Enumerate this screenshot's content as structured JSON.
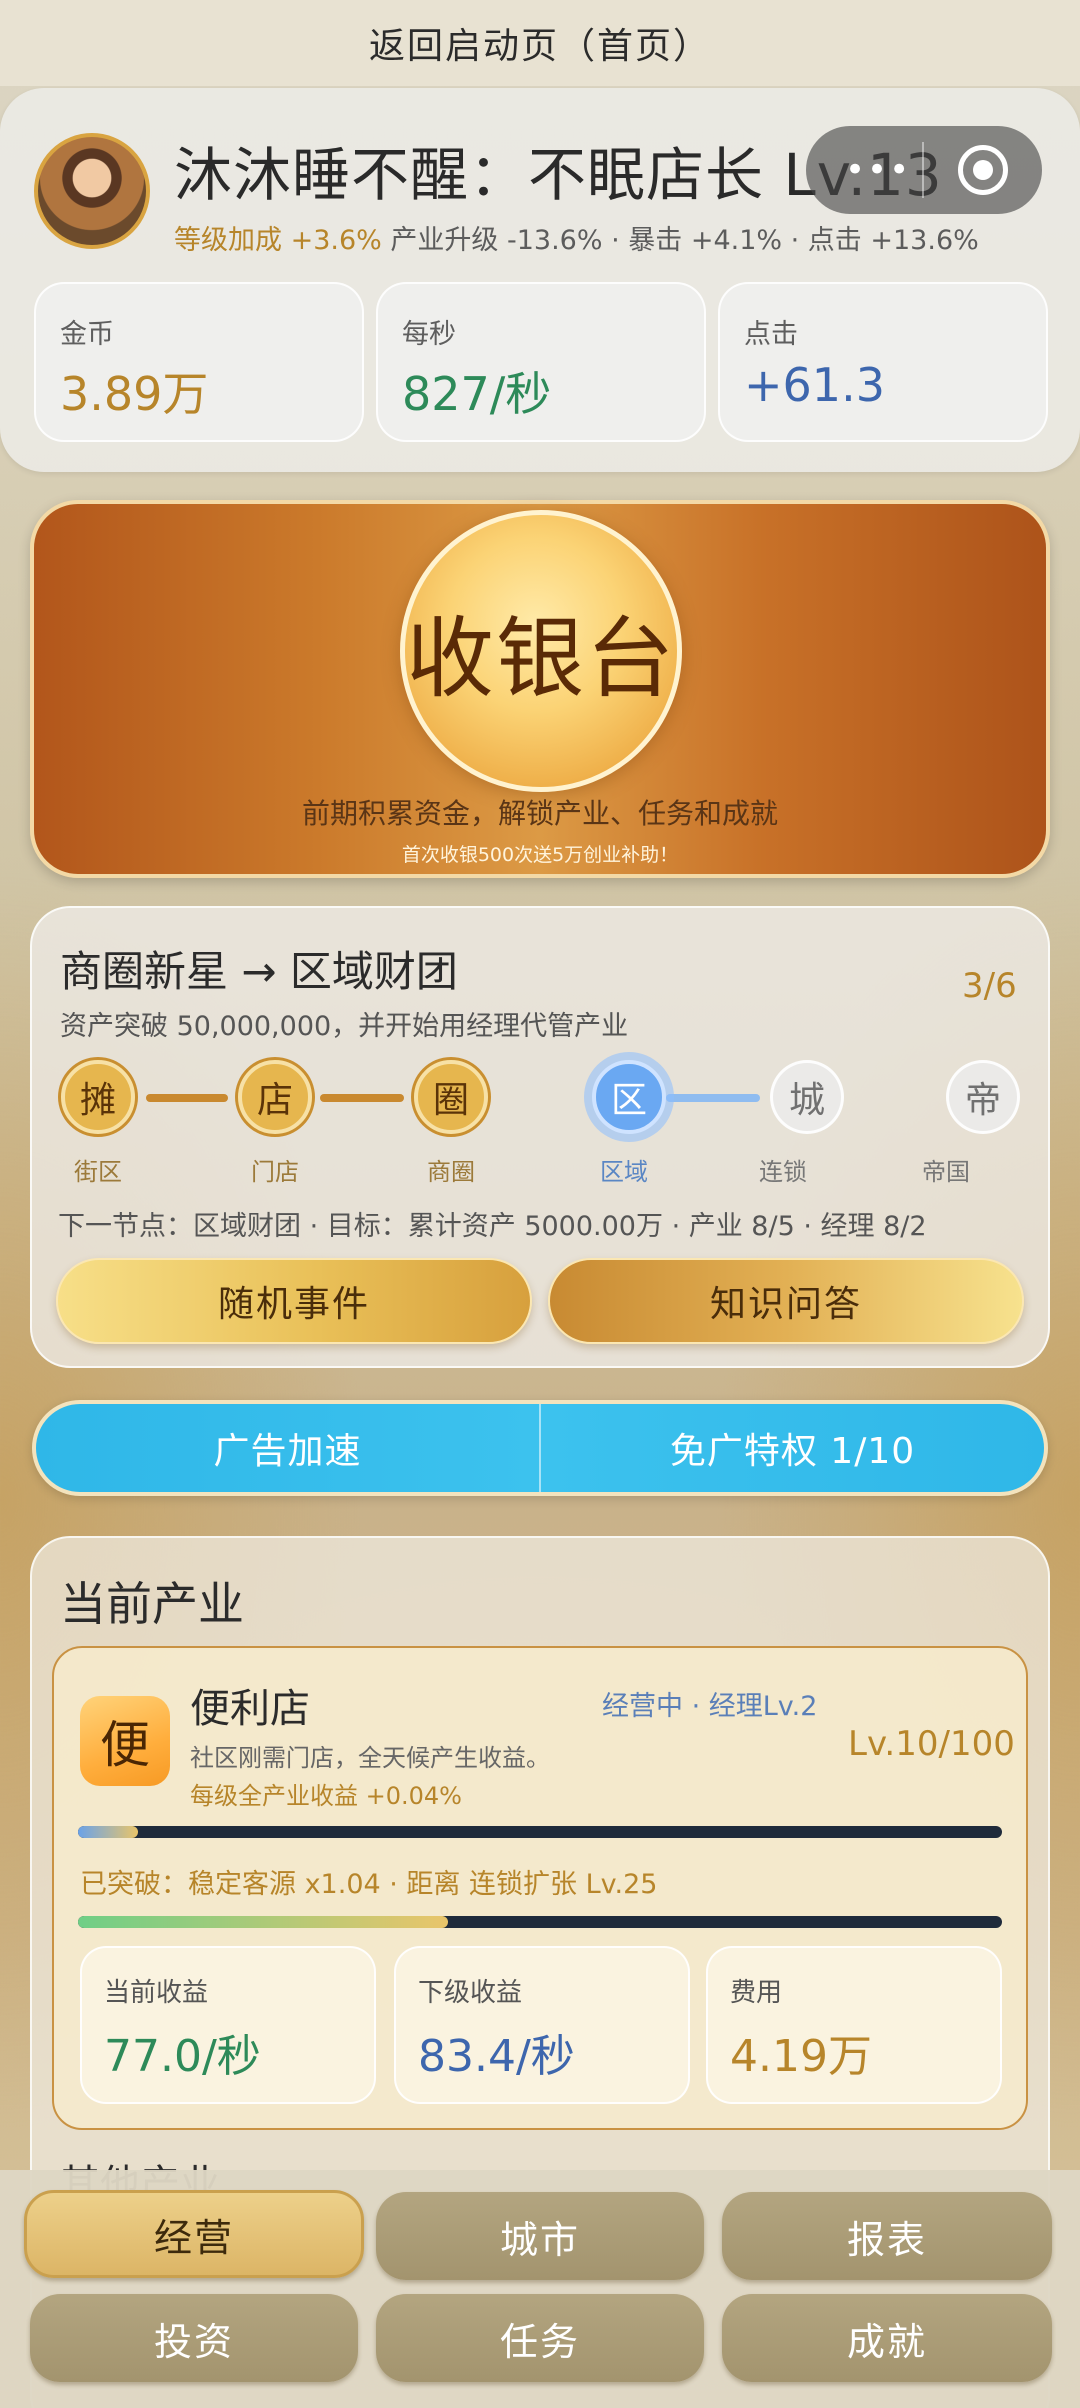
{
  "topbar": {
    "title": "返回启动页（首页）"
  },
  "profile": {
    "name_level": "沐沐睡不醒：不眠店长 Lv.13",
    "capsule_dots": "•••",
    "level_bonus_label": "等级加成",
    "level_bonus_value": "+3.6%",
    "extra_bonus": "产业升级 -13.6% · 暴击 +4.1% · 点击 +13.6%",
    "stats": [
      {
        "label": "金币",
        "value": "3.89万",
        "color": "#b7852a"
      },
      {
        "label": "每秒",
        "value": "827/秒",
        "color": "#2d8a59"
      },
      {
        "label": "点击",
        "value": "+61.3",
        "color": "#3d66ad"
      }
    ]
  },
  "cashier": {
    "button_label": "收银台",
    "description": "前期积累资金，解锁产业、任务和成就",
    "subtext": "首次收银500次送5万创业补助！"
  },
  "stage": {
    "title": "商圈新星 → 区域财团",
    "progress": "3/6",
    "description": "资产突破 50,000,000，并开始用经理代管产业",
    "nodes": [
      {
        "char": "摊",
        "label": "街区",
        "state": "done"
      },
      {
        "char": "店",
        "label": "门店",
        "state": "done"
      },
      {
        "char": "圈",
        "label": "商圈",
        "state": "done"
      },
      {
        "char": "区",
        "label": "区域",
        "state": "current"
      },
      {
        "char": "城",
        "label": "连锁",
        "state": "locked"
      },
      {
        "char": "帝",
        "label": "帝国",
        "state": "locked"
      }
    ],
    "next_info": "下一节点：区域财团 · 目标：累计资产 5000.00万 · 产业 8/5 · 经理 8/2",
    "event_button": "随机事件",
    "quiz_button": "知识问答"
  },
  "ads": {
    "boost_label": "广告加速",
    "privilege_label": "免广特权 1/10"
  },
  "industry": {
    "panel_title": "当前产业",
    "shop": {
      "icon_char": "便",
      "name": "便利店",
      "status": "经营中 · 经理Lv.2",
      "level": "Lv.10/100",
      "description": "社区刚需门店，全天候产生收益。",
      "bonus": "每级全产业收益 +0.04%",
      "level_progress": 0.065,
      "breakthrough": "已突破：稳定客源 x1.04 · 距离 连锁扩张 Lv.25",
      "breakthrough_progress": 0.4,
      "stats": [
        {
          "label": "当前收益",
          "value": "77.0/秒",
          "color": "#2d8a59"
        },
        {
          "label": "下级收益",
          "value": "83.4/秒",
          "color": "#3d66ad"
        },
        {
          "label": "费用",
          "value": "4.19万",
          "color": "#b7852a"
        }
      ]
    },
    "other_title": "其他产业"
  },
  "nav": {
    "items": [
      {
        "label": "经营",
        "active": true
      },
      {
        "label": "城市",
        "active": false
      },
      {
        "label": "报表",
        "active": false
      },
      {
        "label": "投资",
        "active": false
      },
      {
        "label": "任务",
        "active": false
      },
      {
        "label": "成就",
        "active": false
      }
    ]
  }
}
